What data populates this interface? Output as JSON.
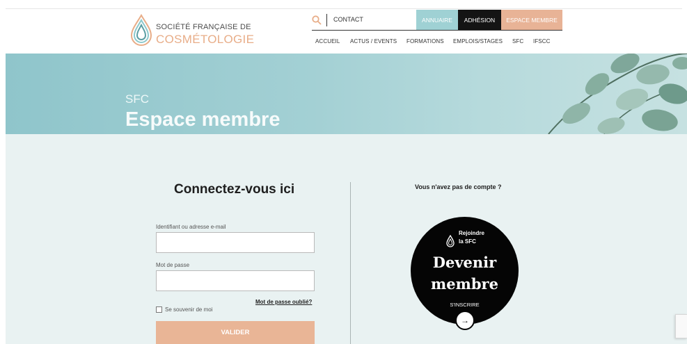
{
  "header": {
    "logo": {
      "line1": "SOCIÉTÉ FRANÇAISE DE",
      "line2": "COSMÉTOLOGIE"
    },
    "contact": "CONTACT",
    "tabs": {
      "annuaire": "ANNUAIRE",
      "adhesion": "ADHÉSION",
      "espace": "ESPACE MEMBRE"
    },
    "nav": [
      "ACCUEIL",
      "ACTUS / EVENTS",
      "FORMATIONS",
      "EMPLOIS/STAGES",
      "SFC",
      "IFSCC"
    ]
  },
  "banner": {
    "kicker": "SFC",
    "title": "Espace membre"
  },
  "login": {
    "title": "Connectez-vous ici",
    "username_label": "Identifiant ou adresse e-mail",
    "username_value": "",
    "password_label": "Mot de passe",
    "password_value": "",
    "forgot": "Mot de passe oublié?",
    "remember": "Se souvenir de moi",
    "submit": "VALIDER"
  },
  "signup": {
    "question": "Vous n'avez pas de compte ?",
    "badge_line1": "Rejoindre",
    "badge_line2": "la SFC",
    "big1": "Devenir",
    "big2": "membre",
    "cta": "S'INSCRIRE",
    "arrow": "→"
  },
  "colors": {
    "accent": "#e9b596",
    "teal": "#9fd1d4",
    "dark": "#141414",
    "page_bg": "#e9f2f2"
  }
}
